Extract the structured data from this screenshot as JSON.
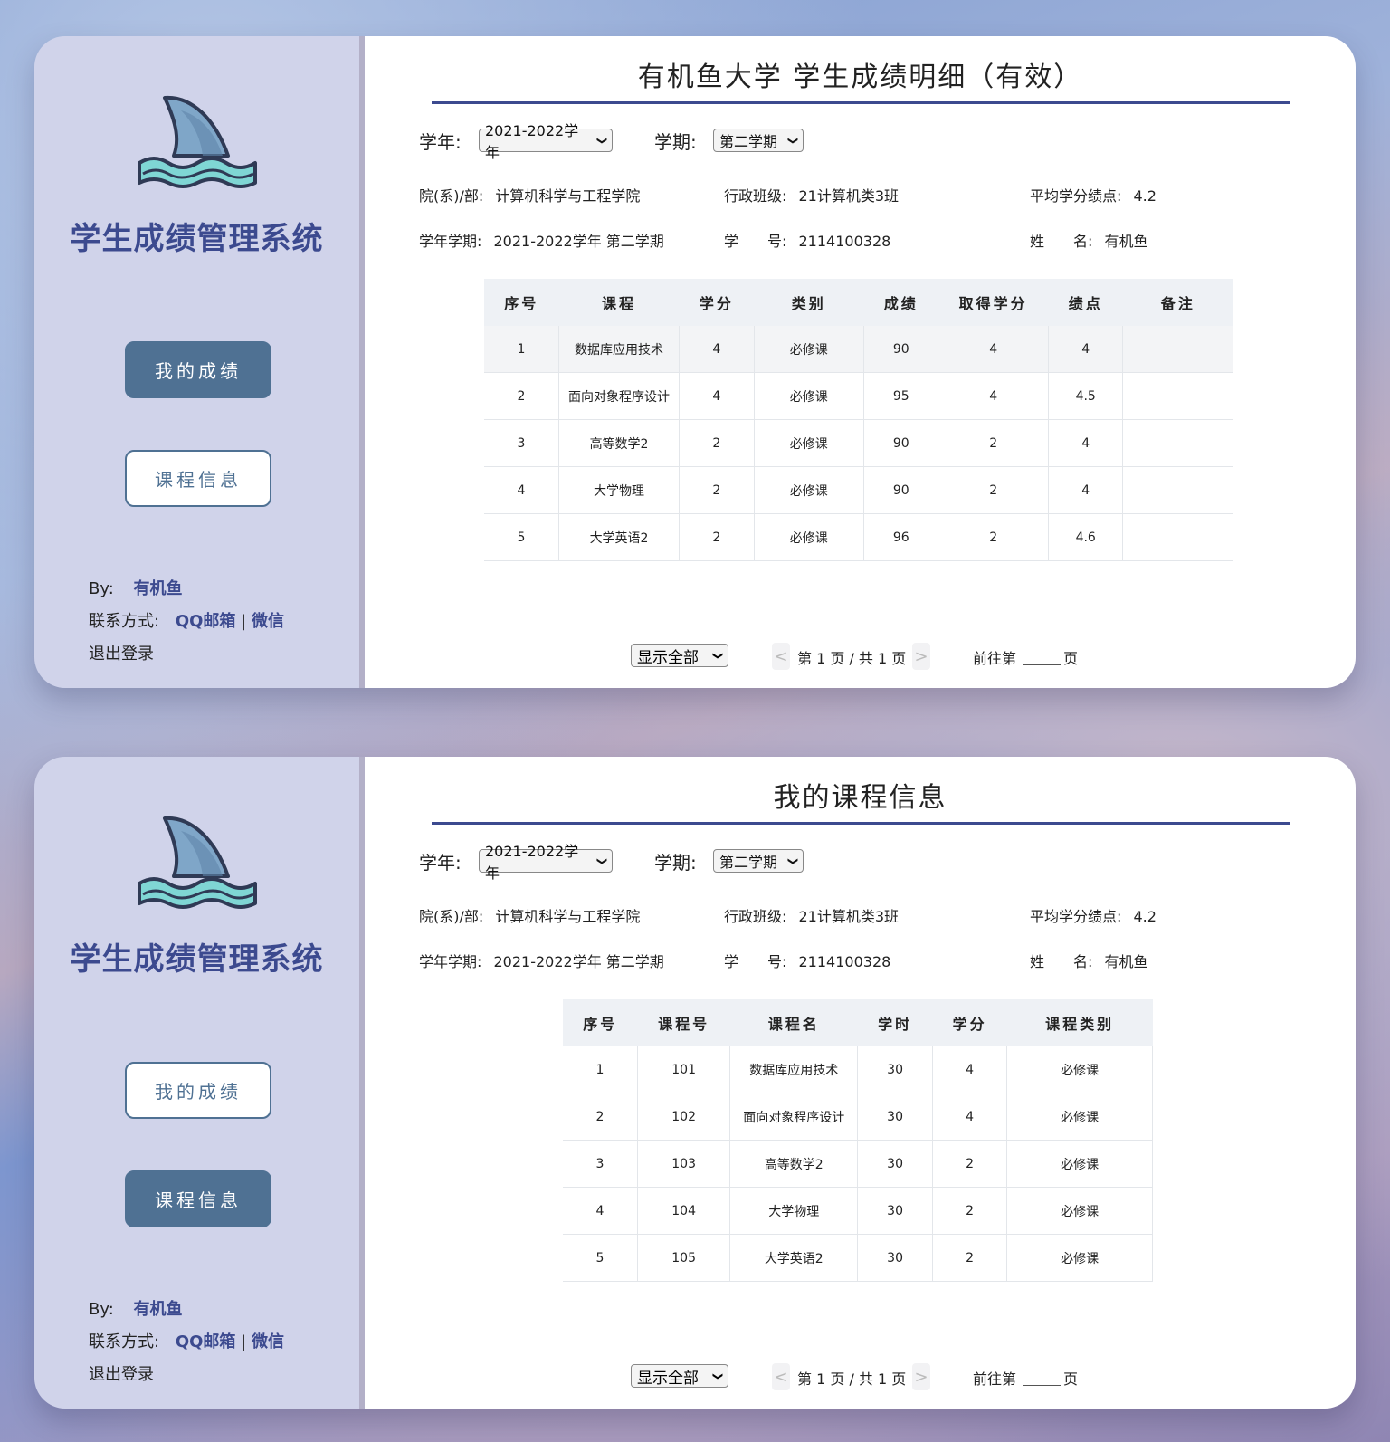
{
  "sidebar": {
    "system_title": "学生成绩管理系统",
    "nav": {
      "grades": "我的成绩",
      "courses": "课程信息"
    },
    "by_label": "By:",
    "author": "有机鱼",
    "contact_label": "联系方式:",
    "qq_mail": "QQ邮箱",
    "separator": "|",
    "wechat": "微信",
    "logout": "退出登录"
  },
  "filters": {
    "year_label": "学年:",
    "year_value": "2021-2022学年",
    "term_label": "学期:",
    "term_value": "第二学期"
  },
  "student": {
    "dept_label": "院(系)/部:",
    "dept": "计算机科学与工程学院",
    "class_label": "行政班级:",
    "class": "21计算机类3班",
    "gpa_label": "平均学分绩点:",
    "gpa": "4.2",
    "term_label": "学年学期:",
    "term": "2021-2022学年 第二学期",
    "id_label": "学　　号:",
    "id": "2114100328",
    "name_label": "姓　　名:",
    "name": "有机鱼"
  },
  "pager": {
    "show_all": "显示全部",
    "prev": "<",
    "next": ">",
    "page_info": "第 1 页 / 共 1 页",
    "goto_prefix": "前往第",
    "goto_suffix": "页"
  },
  "grades_panel": {
    "title": "有机鱼大学 学生成绩明细（有效）",
    "headers": [
      "序号",
      "课程",
      "学分",
      "类别",
      "成绩",
      "取得学分",
      "绩点",
      "备注"
    ],
    "rows": [
      [
        "1",
        "数据库应用技术",
        "4",
        "必修课",
        "90",
        "4",
        "4",
        ""
      ],
      [
        "2",
        "面向对象程序设计",
        "4",
        "必修课",
        "95",
        "4",
        "4.5",
        ""
      ],
      [
        "3",
        "高等数学2",
        "2",
        "必修课",
        "90",
        "2",
        "4",
        ""
      ],
      [
        "4",
        "大学物理",
        "2",
        "必修课",
        "90",
        "2",
        "4",
        ""
      ],
      [
        "5",
        "大学英语2",
        "2",
        "必修课",
        "96",
        "2",
        "4.6",
        ""
      ]
    ]
  },
  "courses_panel": {
    "title": "我的课程信息",
    "headers": [
      "序号",
      "课程号",
      "课程名",
      "学时",
      "学分",
      "课程类别"
    ],
    "rows": [
      [
        "1",
        "101",
        "数据库应用技术",
        "30",
        "4",
        "必修课"
      ],
      [
        "2",
        "102",
        "面向对象程序设计",
        "30",
        "4",
        "必修课"
      ],
      [
        "3",
        "103",
        "高等数学2",
        "30",
        "2",
        "必修课"
      ],
      [
        "4",
        "104",
        "大学物理",
        "30",
        "2",
        "必修课"
      ],
      [
        "5",
        "105",
        "大学英语2",
        "30",
        "2",
        "必修课"
      ]
    ]
  }
}
